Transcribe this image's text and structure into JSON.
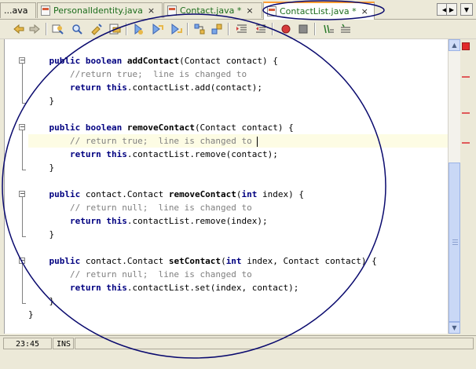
{
  "tabs": [
    {
      "label": "...ava",
      "close": "",
      "active": false
    },
    {
      "label": "PersonalIdentity.java",
      "close": "×",
      "active": false
    },
    {
      "label": "Contact.java *",
      "close": "×",
      "active": false
    },
    {
      "label": "ContactList.java *",
      "close": "×",
      "active": true
    }
  ],
  "tab_nav": {
    "left": "◀",
    "right": "▶",
    "menu": "▼"
  },
  "toolbar_icons": [
    "back-icon",
    "forward-icon",
    "find-icon",
    "find-previous-icon",
    "find-next-icon",
    "find-selection-icon",
    "toggle-highlight-icon",
    "previous-bookmark-icon",
    "next-bookmark-icon",
    "toggle-bookmark-icon",
    "shift-left-icon",
    "shift-right-icon",
    "start-macro-icon",
    "stop-macro-icon",
    "comment-icon",
    "uncomment-icon"
  ],
  "code_lines": [
    {
      "parts": [
        [
          "kw",
          "public "
        ],
        [
          "kw",
          "boolean "
        ],
        [
          "fn",
          "addContact"
        ],
        [
          "",
          "(Contact contact) {"
        ]
      ],
      "indent": 1
    },
    {
      "parts": [
        [
          "cm",
          "//return true;  line is changed to"
        ]
      ],
      "indent": 2
    },
    {
      "parts": [
        [
          "kw",
          "return "
        ],
        [
          "kw",
          "this"
        ],
        [
          "",
          ".contactList.add(contact);"
        ]
      ],
      "indent": 2
    },
    {
      "parts": [
        [
          "",
          "}"
        ]
      ],
      "indent": 1
    },
    {
      "parts": [],
      "indent": 0
    },
    {
      "parts": [
        [
          "kw",
          "public "
        ],
        [
          "kw",
          "boolean "
        ],
        [
          "fn",
          "removeContact"
        ],
        [
          "",
          "(Contact contact) {"
        ]
      ],
      "indent": 1
    },
    {
      "parts": [
        [
          "cm",
          "// return true;  line is changed to "
        ]
      ],
      "indent": 2,
      "caret": true
    },
    {
      "parts": [
        [
          "kw",
          "return "
        ],
        [
          "kw",
          "this"
        ],
        [
          "",
          ".contactList.remove(contact);"
        ]
      ],
      "indent": 2
    },
    {
      "parts": [
        [
          "",
          "}"
        ]
      ],
      "indent": 1
    },
    {
      "parts": [],
      "indent": 0
    },
    {
      "parts": [
        [
          "kw",
          "public "
        ],
        [
          "",
          "contact.Contact "
        ],
        [
          "fn",
          "removeContact"
        ],
        [
          "",
          "("
        ],
        [
          "kw",
          "int "
        ],
        [
          "",
          "index) {"
        ]
      ],
      "indent": 1
    },
    {
      "parts": [
        [
          "cm",
          "// return null;  line is changed to"
        ]
      ],
      "indent": 2
    },
    {
      "parts": [
        [
          "kw",
          "return "
        ],
        [
          "kw",
          "this"
        ],
        [
          "",
          ".contactList.remove(index);"
        ]
      ],
      "indent": 2
    },
    {
      "parts": [
        [
          "",
          "}"
        ]
      ],
      "indent": 1
    },
    {
      "parts": [],
      "indent": 0
    },
    {
      "parts": [
        [
          "kw",
          "public "
        ],
        [
          "",
          "contact.Contact "
        ],
        [
          "fn",
          "setContact"
        ],
        [
          "",
          "("
        ],
        [
          "kw",
          "int "
        ],
        [
          "",
          "index, Contact contact) {"
        ]
      ],
      "indent": 1
    },
    {
      "parts": [
        [
          "cm",
          "// return null;  line is changed to"
        ]
      ],
      "indent": 2
    },
    {
      "parts": [
        [
          "kw",
          "return "
        ],
        [
          "kw",
          "this"
        ],
        [
          "",
          ".contactList.set(index, contact);"
        ]
      ],
      "indent": 2
    },
    {
      "parts": [
        [
          "",
          "}"
        ]
      ],
      "indent": 1
    },
    {
      "parts": [
        [
          "",
          "}"
        ]
      ],
      "indent": 0
    }
  ],
  "scrollbar": {
    "up": "▲",
    "down": "▼"
  },
  "status": {
    "position": "23:45",
    "mode": "INS"
  },
  "colors": {
    "keyword": "#000080",
    "comment": "#808080",
    "annotation": "#0a0a6e",
    "highlight_line": "#fdfce4"
  }
}
